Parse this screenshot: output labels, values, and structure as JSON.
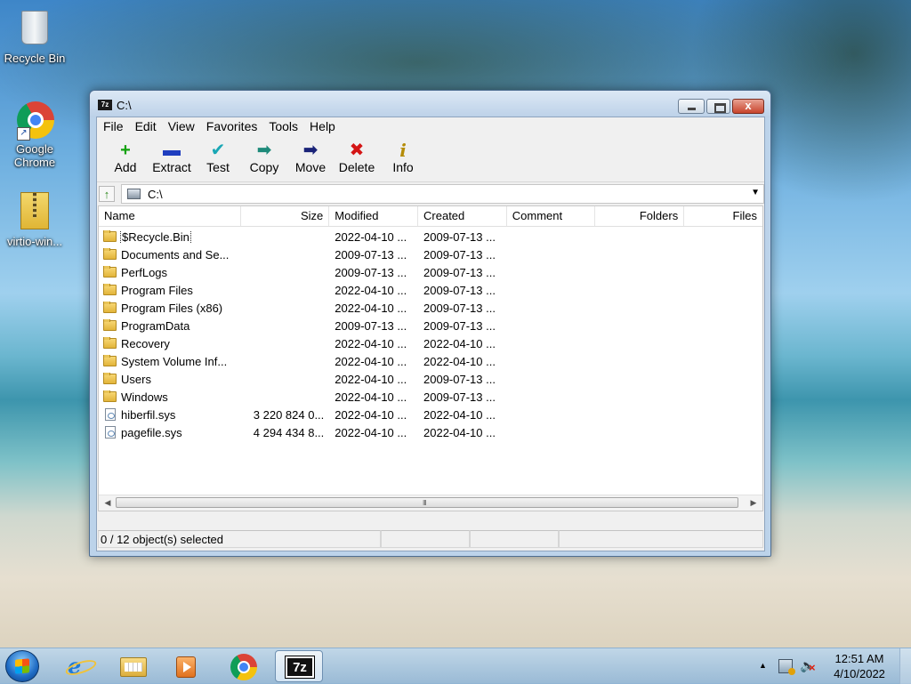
{
  "desktop": {
    "icons": [
      {
        "label": "Recycle Bin"
      },
      {
        "label": "Google Chrome"
      },
      {
        "label": "virtio-win..."
      }
    ]
  },
  "window": {
    "title": "C:\\",
    "app_logo": "7z",
    "close_glyph": "x"
  },
  "menu": [
    "File",
    "Edit",
    "View",
    "Favorites",
    "Tools",
    "Help"
  ],
  "toolbar": [
    {
      "label": "Add",
      "icon": "add-plus-icon"
    },
    {
      "label": "Extract",
      "icon": "extract-minus-icon"
    },
    {
      "label": "Test",
      "icon": "test-check-icon"
    },
    {
      "label": "Copy",
      "icon": "copy-arrow-icon"
    },
    {
      "label": "Move",
      "icon": "move-arrow-icon"
    },
    {
      "label": "Delete",
      "icon": "delete-x-icon"
    },
    {
      "label": "Info",
      "icon": "info-icon"
    }
  ],
  "address": {
    "path": "C:\\"
  },
  "columns": {
    "name": "Name",
    "size": "Size",
    "modified": "Modified",
    "created": "Created",
    "comment": "Comment",
    "folders": "Folders",
    "files": "Files"
  },
  "rows": [
    {
      "name": "$Recycle.Bin",
      "size": "",
      "modified": "2022-04-10 ...",
      "created": "2009-07-13 ...",
      "type": "folder"
    },
    {
      "name": "Documents and Se...",
      "size": "",
      "modified": "2009-07-13 ...",
      "created": "2009-07-13 ...",
      "type": "folder"
    },
    {
      "name": "PerfLogs",
      "size": "",
      "modified": "2009-07-13 ...",
      "created": "2009-07-13 ...",
      "type": "folder"
    },
    {
      "name": "Program Files",
      "size": "",
      "modified": "2022-04-10 ...",
      "created": "2009-07-13 ...",
      "type": "folder"
    },
    {
      "name": "Program Files (x86)",
      "size": "",
      "modified": "2022-04-10 ...",
      "created": "2009-07-13 ...",
      "type": "folder"
    },
    {
      "name": "ProgramData",
      "size": "",
      "modified": "2009-07-13 ...",
      "created": "2009-07-13 ...",
      "type": "folder"
    },
    {
      "name": "Recovery",
      "size": "",
      "modified": "2022-04-10 ...",
      "created": "2022-04-10 ...",
      "type": "folder"
    },
    {
      "name": "System Volume Inf...",
      "size": "",
      "modified": "2022-04-10 ...",
      "created": "2022-04-10 ...",
      "type": "folder"
    },
    {
      "name": "Users",
      "size": "",
      "modified": "2022-04-10 ...",
      "created": "2009-07-13 ...",
      "type": "folder"
    },
    {
      "name": "Windows",
      "size": "",
      "modified": "2022-04-10 ...",
      "created": "2009-07-13 ...",
      "type": "folder"
    },
    {
      "name": "hiberfil.sys",
      "size": "3 220 824 0...",
      "modified": "2022-04-10 ...",
      "created": "2022-04-10 ...",
      "type": "file"
    },
    {
      "name": "pagefile.sys",
      "size": "4 294 434 8...",
      "modified": "2022-04-10 ...",
      "created": "2022-04-10 ...",
      "type": "file"
    }
  ],
  "scrollbar": {
    "grip": "III"
  },
  "status": {
    "selected": "0 / 12 object(s) selected"
  },
  "taskbar": {
    "apps": [
      {
        "name": "internet-explorer",
        "icon": "ie-icon"
      },
      {
        "name": "windows-explorer",
        "icon": "folder-icon"
      },
      {
        "name": "media-player",
        "icon": "media-player-icon"
      },
      {
        "name": "google-chrome",
        "icon": "chrome-icon"
      },
      {
        "name": "7-zip",
        "icon": "7zip-icon",
        "label": "7z",
        "active": true
      }
    ],
    "clock": {
      "time": "12:51 AM",
      "date": "4/10/2022"
    }
  }
}
